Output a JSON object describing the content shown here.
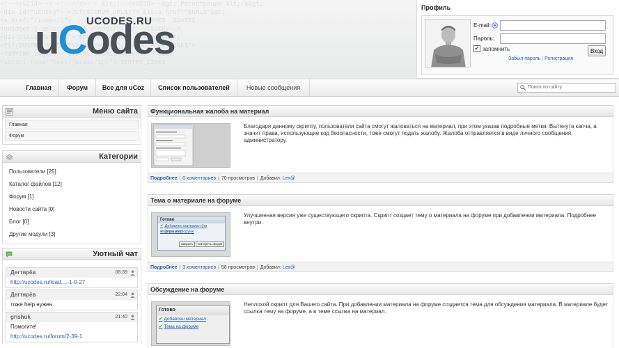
{
  "header": {
    "logo_domain": "UCODES.RU",
    "logo_main_prefix": "u",
    "logo_main_c": "C",
    "logo_main_suffix": "odes",
    "code_background": "<!--<s5214>--> <!--</s>--> &lt;!--<s3219>--&gt; Регистрация &lt;/a&gt; \n<div id=\"uEntry\"> <?if($FORUM_URL$)?> &lt;a href=\"$URL$\"&gt;\n<a href=\"/index/3\">  <!--</s>--> $SITE_NAME$  $DATE$ \n#uWidget { color:#fff } <?endif?> <!--<s5208>--> \n<div class=\"eTitle\"> $COMMENTS_NUM$ &lt;/div&gt; \n<?if($USER_LOGGED_IN$)?> <a href=\"$HOME_PAGE_LINK$\">\n<?$MYINF_1$(10)?> $TOTAL_USERS$ <?endif?> uCoz \n<script type=\"text/javascript\"> $ENTRY_LINK$ "
  },
  "profile": {
    "title": "Профиль",
    "email_label": "E-mail:",
    "password_label": "Пароль:",
    "email_value": "",
    "password_value": "",
    "remember_label": "запомнить",
    "remember_mark": "✔",
    "login_button": "Вход",
    "forgot_link": "Забыл пароль",
    "link_sep": "|",
    "register_link": "Регистрация"
  },
  "nav": {
    "items": [
      "Главная",
      "Форум",
      "Все для uCoz",
      "Список пользователей",
      "Новые сообщения"
    ],
    "search_placeholder": "Поиск по сайту"
  },
  "sidebar": {
    "menu_title": "Меню сайта",
    "menu_items": [
      "Главная",
      "Форум"
    ],
    "categories_title": "Категории",
    "categories": [
      "Пользователи [25]",
      "Каталог файлов [12]",
      "Форум [1]",
      "Новости сайта [0]",
      "Блог [0]",
      "Другие модули [3]"
    ],
    "chat_title": "Уютный чат",
    "chat_messages": [
      {
        "user": "Дегтярёв",
        "time": "08:39",
        "text": "http://ucodes.ru/load....-1-0-27",
        "is_link": true
      },
      {
        "user": "Дегтярёв",
        "time": "22:04",
        "text": "тоже help нужен",
        "is_link": false
      },
      {
        "user": "grishuk",
        "time": "21:40",
        "text": "Помогите!",
        "text2": "http://ucodes.ru/forum/2-39-1",
        "is_link": false
      }
    ]
  },
  "entries": [
    {
      "title": "Функциональная жалоба на материал",
      "text": "Благодаря данному скрипту, пользователи сайта смогут жаловаться на материал, при этом указав подробные метки. Вытянута капча, а значит права, использующие код безопасности, тоже смогут подать жалобу. Жалоба отправляется в виде личного сообщения, администратору.",
      "more": "Подробнее",
      "comments": "0 коментариев",
      "views": "70 просмотров",
      "added_label": "Добавил:",
      "author": "Lex@"
    },
    {
      "title": "Тема о материале на форуме",
      "text": "Улучшенная версия уже существующего скрипта. Скрипт создает тему о материала на форуме при добавлении материала. Подробнее внутри.",
      "more": "Подробнее",
      "comments": "3 коментариев",
      "views": "58 просмотров",
      "added_label": "Добавил:",
      "author": "Lex@",
      "thumb": {
        "window_title": "Готово",
        "line1": "Добавлен материал",
        "line1_note": "(на модерации)",
        "line2": "Тема на форуме",
        "btn1": "Закрыть",
        "btn2": "Смотреть форум"
      }
    },
    {
      "title": "Обсуждение на форуме",
      "text": "Неплохой скрипт для Вашего сайта. При добавлении материала на форуме создается тема для обсуждения материала. В материале будет ссылка тему на форуме, а в теме ссылка на материал.",
      "thumb": {
        "window_title": "Готово",
        "line1": "Добавлен материал",
        "line2": "Тема на форуме"
      }
    }
  ],
  "colors": {
    "link": "#2b5fa8",
    "logo_accent": "#1e8fd8",
    "logo_main": "#4a5058"
  }
}
